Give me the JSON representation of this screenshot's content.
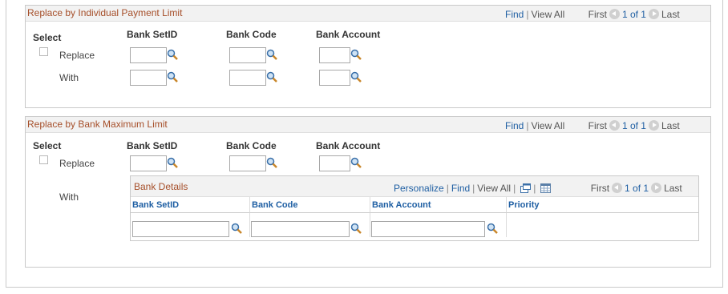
{
  "section1": {
    "title": "Replace by Individual Payment Limit",
    "nav": {
      "find": "Find",
      "view_all": "View All",
      "first": "First",
      "count": "1 of 1",
      "last": "Last"
    },
    "select_label": "Select",
    "col_setid": "Bank SetID",
    "col_code": "Bank Code",
    "col_account": "Bank Account",
    "replace_label": "Replace",
    "with_label": "With"
  },
  "section2": {
    "title": "Replace by Bank Maximum Limit",
    "nav": {
      "find": "Find",
      "view_all": "View All",
      "first": "First",
      "count": "1 of 1",
      "last": "Last"
    },
    "select_label": "Select",
    "col_setid": "Bank SetID",
    "col_code": "Bank Code",
    "col_account": "Bank Account",
    "replace_label": "Replace",
    "with_label": "With",
    "bank_details": {
      "title": "Bank Details",
      "nav": {
        "personalize": "Personalize",
        "find": "Find",
        "view_all": "View All",
        "first": "First",
        "count": "1 of 1",
        "last": "Last"
      },
      "columns": [
        "Bank SetID",
        "Bank Code",
        "Bank Account",
        "Priority"
      ]
    }
  },
  "colors": {
    "title": "#a64f2a",
    "link": "#1f5fa3",
    "header_bg": "#f2f2f2",
    "border": "#c9c9c9"
  }
}
